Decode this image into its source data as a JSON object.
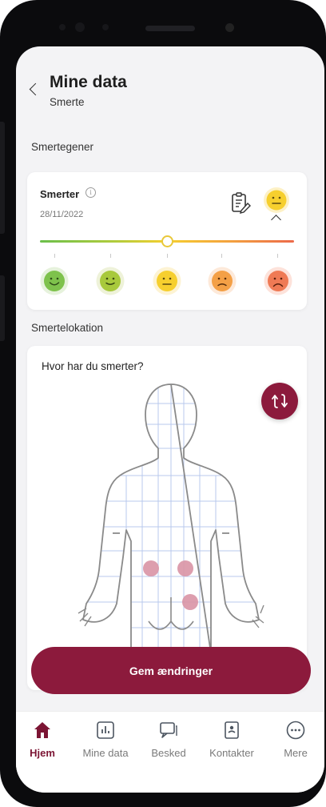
{
  "header": {
    "title": "Mine data",
    "subtitle": "Smerte"
  },
  "sections": {
    "pain_scores": "Smertegener",
    "pain_location": "Smertelokation"
  },
  "pain_card": {
    "label": "Smerter",
    "info_icon": "info-icon",
    "date": "28/11/2022",
    "notes_icon": "notes-icon",
    "current_level": "neutral",
    "slider_value_fraction": 0.5,
    "scale": [
      {
        "name": "very-happy-face-icon",
        "color": "#7ec24c"
      },
      {
        "name": "happy-face-icon",
        "color": "#a8c93c"
      },
      {
        "name": "neutral-face-icon",
        "color": "#f6cf2e"
      },
      {
        "name": "sad-face-icon",
        "color": "#f4a046"
      },
      {
        "name": "very-sad-face-icon",
        "color": "#ef7a55"
      }
    ]
  },
  "body_map": {
    "question": "Hvor har du smerter?",
    "rotate_icon": "rotate-icon",
    "view": "back",
    "marked_spots": 3,
    "spot_color": "#d993a5"
  },
  "actions": {
    "save_label": "Gem ændringer"
  },
  "nav": {
    "items": [
      {
        "label": "Hjem",
        "icon": "home-icon",
        "active": true
      },
      {
        "label": "Mine data",
        "icon": "chart-icon",
        "active": false
      },
      {
        "label": "Besked",
        "icon": "message-icon",
        "active": false
      },
      {
        "label": "Kontakter",
        "icon": "contacts-icon",
        "active": false
      },
      {
        "label": "Mere",
        "icon": "more-icon",
        "active": false
      }
    ]
  },
  "colors": {
    "accent": "#8c1a3c",
    "accent_text": "#7c1534",
    "background": "#f3f3f5"
  }
}
